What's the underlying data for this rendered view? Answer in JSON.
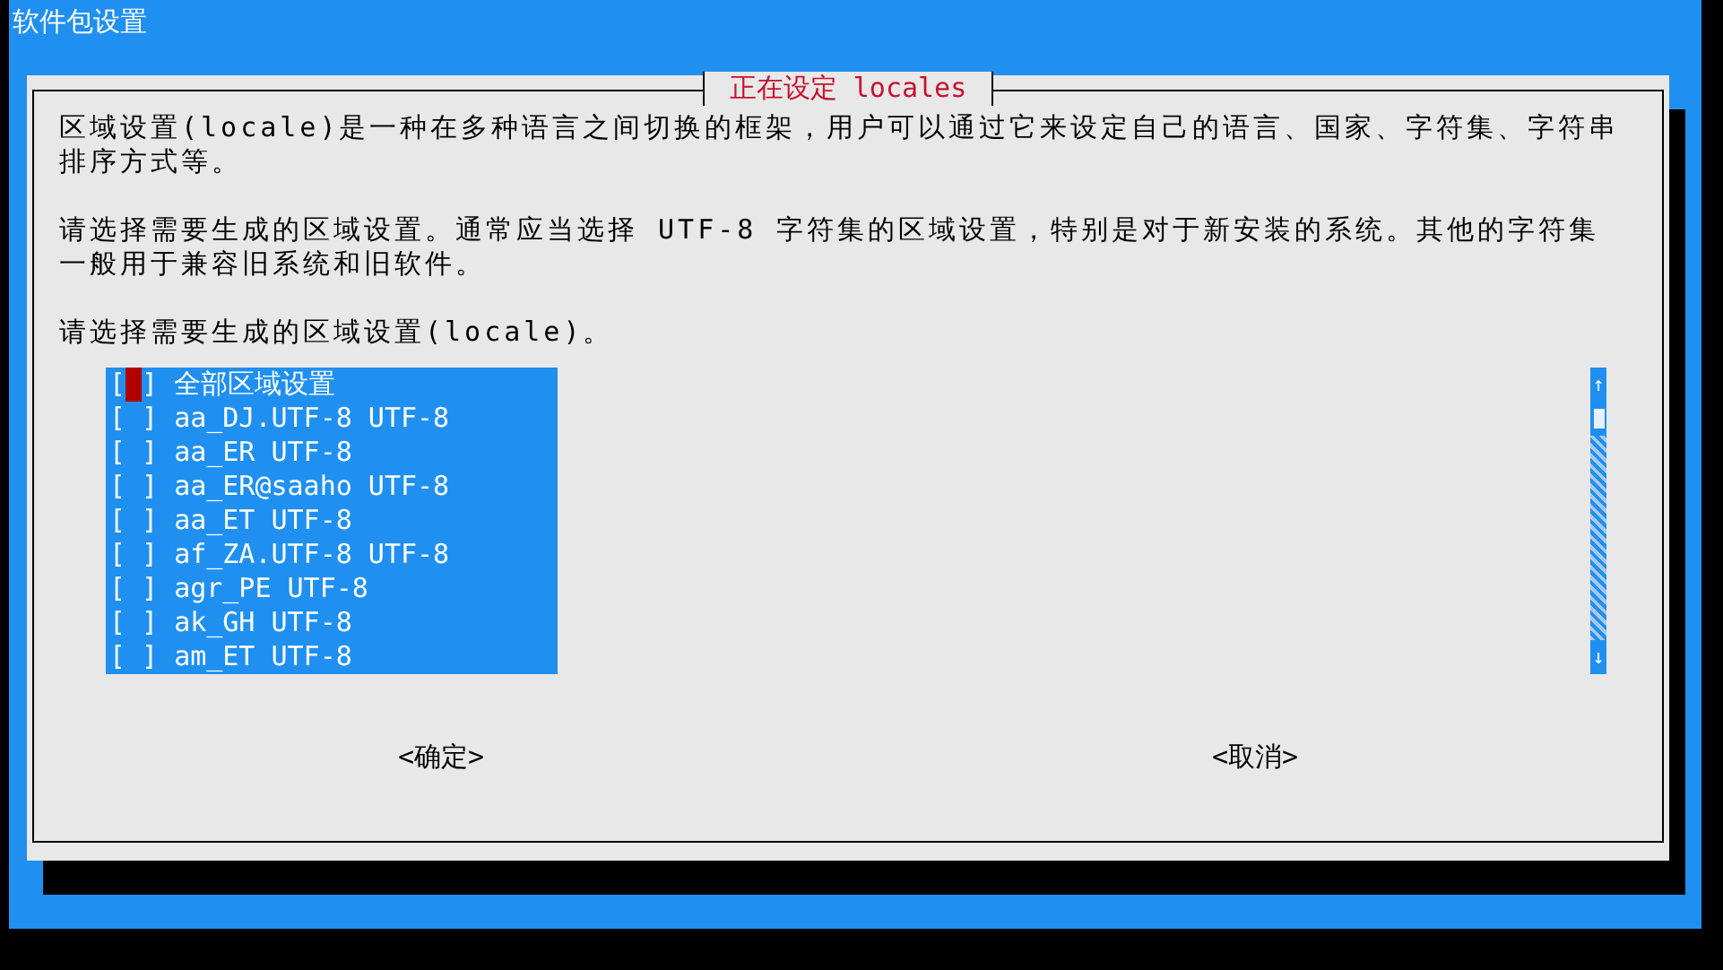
{
  "window": {
    "title": "软件包设置"
  },
  "dialog": {
    "title": "正在设定 locales",
    "paragraphs": [
      "区域设置(locale)是一种在多种语言之间切换的框架，用户可以通过它来设定自己的语言、国家、字符集、字符串排序方式等。",
      "请选择需要生成的区域设置。通常应当选择 UTF-8 字符集的区域设置，特别是对于新安装的系统。其他的字符集一般用于兼容旧系统和旧软件。",
      "请选择需要生成的区域设置(locale)。"
    ],
    "items": [
      {
        "open": "[",
        "close": "]",
        "label": "全部区域设置",
        "checked": false,
        "focused": true
      },
      {
        "open": "[",
        "close": "]",
        "label": "aa_DJ.UTF-8 UTF-8",
        "checked": false,
        "focused": false
      },
      {
        "open": "[",
        "close": "]",
        "label": "aa_ER UTF-8",
        "checked": false,
        "focused": false
      },
      {
        "open": "[",
        "close": "]",
        "label": "aa_ER@saaho UTF-8",
        "checked": false,
        "focused": false
      },
      {
        "open": "[",
        "close": "]",
        "label": "aa_ET UTF-8",
        "checked": false,
        "focused": false
      },
      {
        "open": "[",
        "close": "]",
        "label": "af_ZA.UTF-8 UTF-8",
        "checked": false,
        "focused": false
      },
      {
        "open": "[",
        "close": "]",
        "label": "agr_PE UTF-8",
        "checked": false,
        "focused": false
      },
      {
        "open": "[",
        "close": "]",
        "label": "ak_GH UTF-8",
        "checked": false,
        "focused": false
      },
      {
        "open": "[",
        "close": "]",
        "label": "am_ET UTF-8",
        "checked": false,
        "focused": false
      }
    ],
    "scroll_up": "↑",
    "scroll_down": "↓",
    "buttons": [
      {
        "label": "<确定>",
        "selected": false
      },
      {
        "label": "<取消>",
        "selected": false
      }
    ]
  }
}
